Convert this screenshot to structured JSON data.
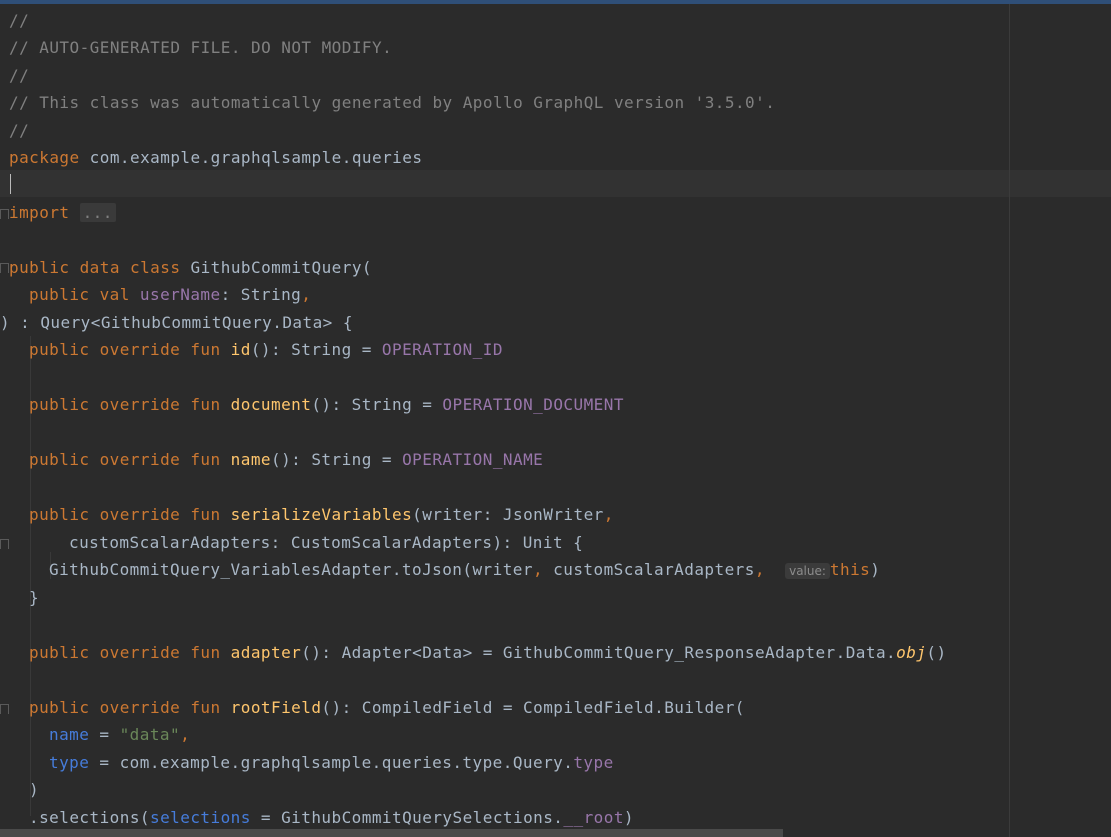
{
  "editor": {
    "lines": {
      "l1": "//",
      "l2": "// AUTO-GENERATED FILE. DO NOT MODIFY.",
      "l3": "//",
      "l4": "// This class was automatically generated by Apollo GraphQL version '3.5.0'.",
      "l5": "//",
      "l6_kw": "package",
      "l6_pkg": " com.example.graphqlsample.queries",
      "l8_kw": "import",
      "l8_fold": "...",
      "l10_kw": "public data class",
      "l10_name": " GithubCommitQuery(",
      "l11_kw": "public val",
      "l11_prop": " userName",
      "l11_type": ": String",
      "l11_comma": ",",
      "l12": ") : Query<GithubCommitQuery.Data> {",
      "l13_kw": "public override fun",
      "l13_fn": " id",
      "l13_rest": "(): String = ",
      "l13_const": "OPERATION_ID",
      "l15_kw": "public override fun",
      "l15_fn": " document",
      "l15_rest": "(): String = ",
      "l15_const": "OPERATION_DOCUMENT",
      "l17_kw": "public override fun",
      "l17_fn": " name",
      "l17_rest": "(): String = ",
      "l17_const": "OPERATION_NAME",
      "l19_kw": "public override fun",
      "l19_fn": " serializeVariables",
      "l19_rest": "(writer: JsonWriter",
      "l19_comma": ",",
      "l20": "customScalarAdapters: CustomScalarAdapters): Unit {",
      "l21_code": "GithubCommitQuery_VariablesAdapter.toJson(writer",
      "l21_comma1": ",",
      "l21_mid": " customScalarAdapters",
      "l21_comma2": ",",
      "l21_hint": "value:",
      "l21_this": "this",
      "l21_close": ")",
      "l22": "}",
      "l24_kw": "public override fun",
      "l24_fn": " adapter",
      "l24_rest": "(): Adapter<Data> = GithubCommitQuery_ResponseAdapter.Data.",
      "l24_obj": "obj",
      "l24_end": "()",
      "l26_kw": "public override fun",
      "l26_fn": " rootField",
      "l26_rest": "(): CompiledField = CompiledField.Builder(",
      "l27_param": "name",
      "l27_eq": " = ",
      "l27_str": "\"data\"",
      "l27_comma": ",",
      "l28_param": "type",
      "l28_eq": " = com.example.graphqlsample.queries.type.Query.",
      "l28_prop": "type",
      "l29": ")",
      "l30_pre": ".selections(",
      "l30_param": "selections",
      "l30_rest": " = GithubCommitQuerySelections.",
      "l30_prop": "__root",
      "l30_close": ")"
    }
  },
  "colors": {
    "background": "#2b2b2b",
    "comment": "#808080",
    "keyword": "#cc7832",
    "function": "#ffc66d",
    "constant": "#9876aa",
    "named_param": "#467cda",
    "string": "#6a8759",
    "text": "#a9b7c6"
  }
}
